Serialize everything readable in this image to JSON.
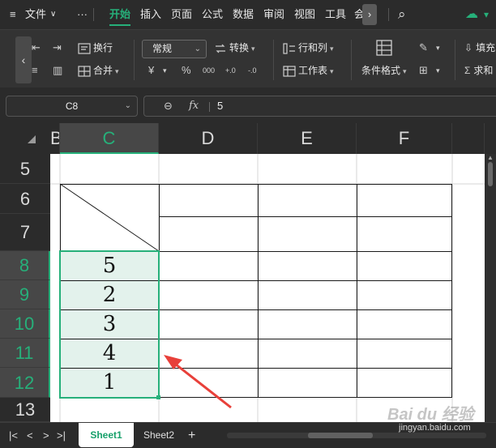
{
  "menubar": {
    "hamburger_icon": "≡",
    "file_label": "文件",
    "more_icon": "···",
    "items": [
      "开始",
      "插入",
      "页面",
      "公式",
      "数据",
      "审阅",
      "视图",
      "工具",
      "会"
    ],
    "active_item": "开始",
    "scroll_right_icon": "›",
    "search_icon": "⌕",
    "cloud_icon": "☁"
  },
  "ribbon": {
    "collapse_icon": "‹",
    "wrap_label": "换行",
    "merge_label": "合并",
    "number_format": "常规",
    "convert_label": "转换",
    "rows_cols_label": "行和列",
    "worksheet_label": "工作表",
    "cond_format_label": "条件格式",
    "fill_label": "填充",
    "sum_label": "求和",
    "currency_icon": "¥",
    "percent_icon": "%",
    "thousands_icon": "000",
    "inc_decimal_icon": "+.0",
    "dec_decimal_icon": "-.0"
  },
  "formula_bar": {
    "cell_ref": "C8",
    "zoom_icon": "⊖",
    "fx_label": "fx",
    "value": "5"
  },
  "columns": [
    "B",
    "C",
    "D",
    "E",
    "F"
  ],
  "selected_column": "C",
  "rows": [
    "5",
    "6",
    "7",
    "8",
    "9",
    "10",
    "11",
    "12",
    "13"
  ],
  "selected_rows": [
    "8",
    "9",
    "10",
    "11",
    "12"
  ],
  "cells": {
    "C8": "5",
    "C9": "2",
    "C10": "3",
    "C11": "4",
    "C12": "1"
  },
  "colors": {
    "accent": "#26b07a",
    "selection_fill": "#e3f2ec",
    "annotation_arrow": "#e8403a"
  },
  "sheet_tabs": {
    "nav_first": "|<",
    "nav_prev": "<",
    "nav_next": ">",
    "nav_last": ">|",
    "tabs": [
      "Sheet1",
      "Sheet2"
    ],
    "active_tab": "Sheet1",
    "add_icon": "+"
  },
  "watermark": {
    "logo_text": "Bai du 经验",
    "url_text": "jingyan.baidu.com"
  }
}
